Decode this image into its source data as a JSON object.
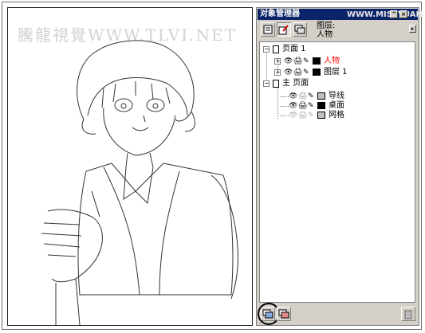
{
  "watermark_left": "騰龍視覺WWW.TLVI.NET",
  "watermark_right": "WWW.MISSYUAN.COM",
  "panel": {
    "title": "对象管理器",
    "layer_label_line1": "图层:",
    "layer_label_line2": "人物"
  },
  "tree": {
    "page1": "页面 1",
    "layer_people": "人物",
    "layer_1": "图层 1",
    "master": "主 页面",
    "guides": "导线",
    "desktop": "桌面",
    "grid": "网格"
  },
  "colors": {
    "active_layer": "#ff0000",
    "swatch_dark": "#000000",
    "swatch_gray": "#c0c0c0"
  },
  "icons": [
    "page-icon",
    "eye-icon",
    "printer-icon",
    "pencil-icon",
    "new-layer-icon",
    "delete-icon"
  ]
}
